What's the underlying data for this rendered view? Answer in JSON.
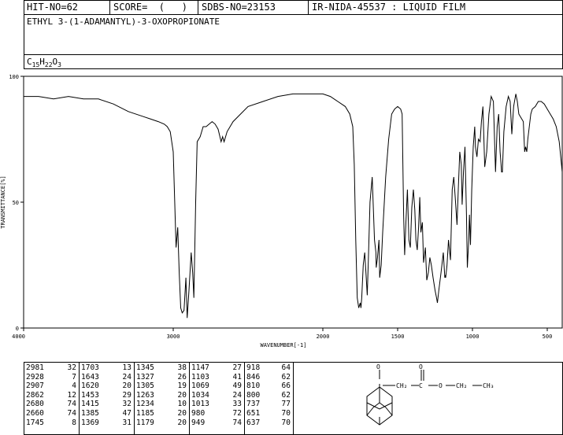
{
  "header": {
    "hit": "HIT-NO=62",
    "score": "SCORE=  (   )",
    "sdbs": "SDBS-NO=23153",
    "ir": "IR-NIDA-45537 : LIQUID FILM"
  },
  "compound_name": "ETHYL 3-(1-ADAMANTYL)-3-OXOPROPIONATE",
  "formula": {
    "c": "C",
    "c_n": "15",
    "h": "H",
    "h_n": "22",
    "o": "O",
    "o_n": "3"
  },
  "peaks": [
    [
      [
        "2981",
        "32"
      ],
      [
        "2928",
        "7"
      ],
      [
        "2907",
        "4"
      ],
      [
        "2862",
        "12"
      ],
      [
        "2680",
        "74"
      ],
      [
        "2660",
        "74"
      ],
      [
        "1745",
        "8"
      ]
    ],
    [
      [
        "1703",
        "13"
      ],
      [
        "1643",
        "24"
      ],
      [
        "1620",
        "20"
      ],
      [
        "1453",
        "29"
      ],
      [
        "1415",
        "32"
      ],
      [
        "1385",
        "47"
      ],
      [
        "1369",
        "31"
      ]
    ],
    [
      [
        "1345",
        "38"
      ],
      [
        "1327",
        "26"
      ],
      [
        "1305",
        "19"
      ],
      [
        "1263",
        "20"
      ],
      [
        "1234",
        "10"
      ],
      [
        "1185",
        "20"
      ],
      [
        "1179",
        "20"
      ]
    ],
    [
      [
        "1147",
        "27"
      ],
      [
        "1103",
        "41"
      ],
      [
        "1069",
        "49"
      ],
      [
        "1034",
        "24"
      ],
      [
        "1013",
        "33"
      ],
      [
        "980",
        "72"
      ],
      [
        "949",
        "74"
      ]
    ],
    [
      [
        "918",
        "64"
      ],
      [
        "846",
        "62"
      ],
      [
        "810",
        "66"
      ],
      [
        "800",
        "62"
      ],
      [
        "737",
        "77"
      ],
      [
        "651",
        "70"
      ],
      [
        "637",
        "70"
      ]
    ]
  ],
  "structure_labels": {
    "o1": "O",
    "o2": "O",
    "o3": "O",
    "ch2a": "CH₂",
    "c": "C",
    "ch2b": "CH₂",
    "ch3": "CH₃"
  },
  "colors": {
    "ink": "#000000",
    "background": "#ffffff"
  },
  "chart_data": {
    "type": "line",
    "xlabel": "WAVENUMBER[-1]",
    "ylabel": "TRANSMITTANCE[%]",
    "xlim": [
      4000,
      400
    ],
    "ylim": [
      0,
      100
    ],
    "x_ticks": [
      4000,
      3000,
      2000,
      1500,
      1000,
      500
    ],
    "y_ticks": [
      0,
      50,
      100
    ],
    "grid": false,
    "series": [
      {
        "x": [
          4000,
          3900,
          3800,
          3700,
          3600,
          3500,
          3400,
          3300,
          3200,
          3150,
          3100,
          3060,
          3040,
          3020,
          3000,
          2990,
          2981,
          2970,
          2960,
          2950,
          2940,
          2928,
          2915,
          2907,
          2895,
          2880,
          2870,
          2862,
          2850,
          2840,
          2820,
          2800,
          2780,
          2760,
          2740,
          2720,
          2700,
          2680,
          2670,
          2660,
          2640,
          2600,
          2500,
          2400,
          2300,
          2200,
          2100,
          2000,
          1950,
          1900,
          1850,
          1820,
          1800,
          1790,
          1780,
          1770,
          1760,
          1750,
          1745,
          1740,
          1730,
          1720,
          1710,
          1703,
          1695,
          1685,
          1670,
          1655,
          1645,
          1643,
          1635,
          1625,
          1620,
          1610,
          1600,
          1580,
          1560,
          1540,
          1520,
          1500,
          1480,
          1470,
          1460,
          1453,
          1445,
          1435,
          1425,
          1415,
          1405,
          1395,
          1385,
          1378,
          1369,
          1360,
          1352,
          1345,
          1335,
          1327,
          1315,
          1305,
          1295,
          1285,
          1275,
          1263,
          1250,
          1240,
          1234,
          1225,
          1210,
          1195,
          1185,
          1182,
          1179,
          1170,
          1160,
          1147,
          1135,
          1125,
          1115,
          1103,
          1095,
          1085,
          1075,
          1069,
          1060,
          1050,
          1040,
          1034,
          1025,
          1020,
          1013,
          1005,
          995,
          985,
          980,
          970,
          960,
          949,
          940,
          930,
          918,
          905,
          890,
          875,
          860,
          846,
          835,
          825,
          815,
          810,
          805,
          800,
          790,
          775,
          760,
          748,
          737,
          725,
          710,
          700,
          690,
          680,
          670,
          660,
          651,
          645,
          637,
          630,
          620,
          610,
          600,
          580,
          560,
          540,
          520,
          500,
          480,
          460,
          440,
          420,
          400
        ],
        "y": [
          92,
          92,
          91,
          92,
          91,
          91,
          89,
          86,
          84,
          83,
          82,
          81,
          80,
          78,
          70,
          50,
          32,
          40,
          22,
          8,
          6,
          7,
          20,
          4,
          15,
          30,
          22,
          12,
          50,
          74,
          76,
          80,
          80,
          81,
          82,
          81,
          79,
          74,
          76,
          74,
          78,
          82,
          88,
          90,
          92,
          93,
          93,
          93,
          92,
          90,
          88,
          85,
          80,
          65,
          35,
          12,
          8,
          10,
          8,
          12,
          25,
          30,
          20,
          13,
          28,
          50,
          60,
          35,
          30,
          24,
          28,
          35,
          20,
          25,
          38,
          60,
          75,
          85,
          87,
          88,
          87,
          85,
          45,
          29,
          42,
          55,
          35,
          32,
          48,
          55,
          47,
          35,
          31,
          40,
          52,
          38,
          42,
          26,
          32,
          19,
          22,
          28,
          25,
          20,
          15,
          12,
          10,
          15,
          22,
          30,
          20,
          21,
          20,
          25,
          35,
          27,
          55,
          60,
          52,
          41,
          55,
          70,
          65,
          49,
          62,
          72,
          45,
          24,
          35,
          45,
          33,
          55,
          72,
          80,
          72,
          68,
          75,
          74,
          82,
          88,
          64,
          70,
          85,
          92,
          90,
          62,
          80,
          85,
          70,
          66,
          62,
          62,
          78,
          88,
          92,
          90,
          77,
          88,
          93,
          90,
          85,
          84,
          83,
          82,
          70,
          72,
          70,
          75,
          80,
          85,
          87,
          88,
          90,
          90,
          89,
          87,
          85,
          83,
          80,
          74,
          62
        ]
      }
    ]
  }
}
